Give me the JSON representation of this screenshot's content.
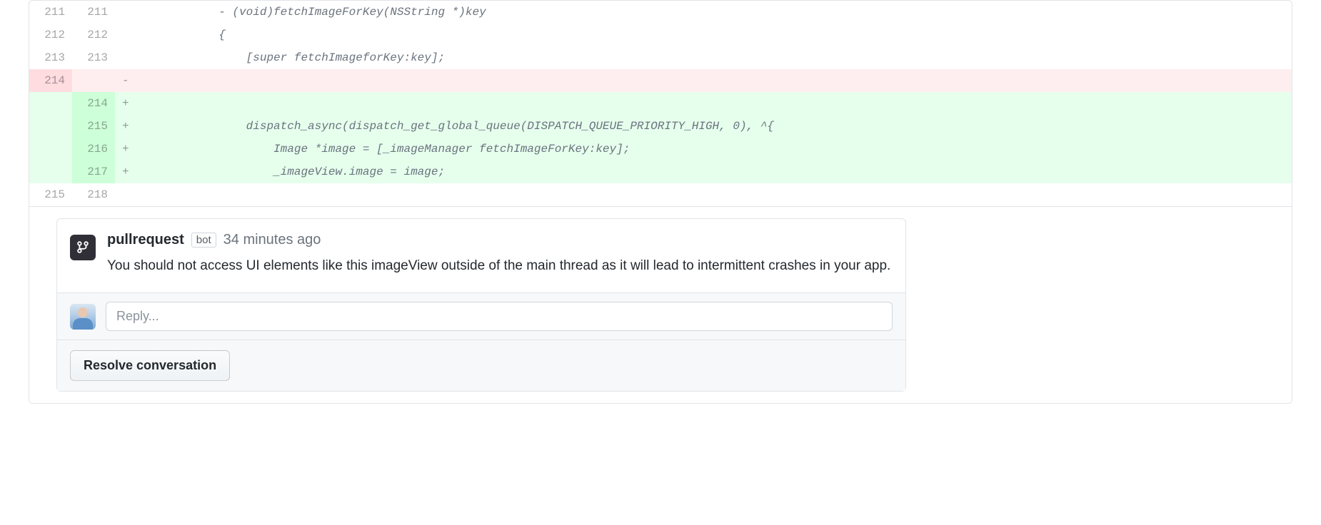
{
  "diff": {
    "lines": [
      {
        "old": "211",
        "new": "211",
        "marker": "",
        "type": "context",
        "code": "           - (void)fetchImageForKey(NSString *)key"
      },
      {
        "old": "212",
        "new": "212",
        "marker": "",
        "type": "context",
        "code": "           {"
      },
      {
        "old": "213",
        "new": "213",
        "marker": "",
        "type": "context",
        "code": "               [super fetchImageforKey:key];"
      },
      {
        "old": "214",
        "new": "",
        "marker": "-",
        "type": "removed",
        "code": ""
      },
      {
        "old": "",
        "new": "214",
        "marker": "+",
        "type": "added",
        "code": ""
      },
      {
        "old": "",
        "new": "215",
        "marker": "+",
        "type": "added",
        "code": "               dispatch_async(dispatch_get_global_queue(DISPATCH_QUEUE_PRIORITY_HIGH, 0), ^{"
      },
      {
        "old": "",
        "new": "216",
        "marker": "+",
        "type": "added",
        "code": "                   Image *image = [_imageManager fetchImageForKey:key];"
      },
      {
        "old": "",
        "new": "217",
        "marker": "+",
        "type": "added",
        "code": "                   _imageView.image = image;"
      },
      {
        "old": "215",
        "new": "218",
        "marker": "",
        "type": "context",
        "code": ""
      }
    ]
  },
  "comment": {
    "author": "pullrequest",
    "badge": "bot",
    "timestamp": "34 minutes ago",
    "body": "You should not access UI elements like this imageView outside of the main thread as it will lead to intermittent crashes in your app."
  },
  "reply": {
    "placeholder": "Reply..."
  },
  "actions": {
    "resolve": "Resolve conversation"
  }
}
